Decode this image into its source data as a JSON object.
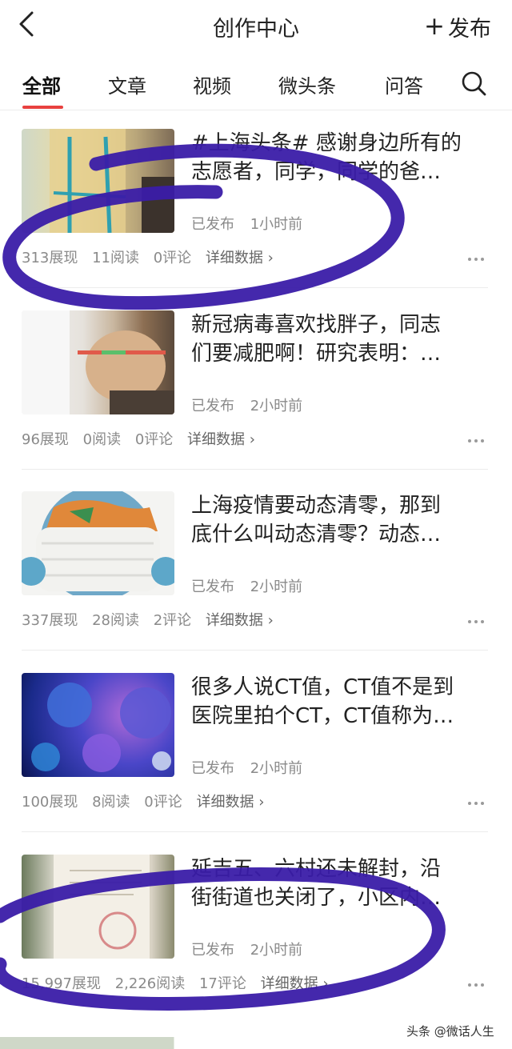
{
  "header": {
    "title": "创作中心",
    "publish_label": "发布"
  },
  "tabs": [
    {
      "label": "全部",
      "active": true
    },
    {
      "label": "文章",
      "active": false
    },
    {
      "label": "视频",
      "active": false
    },
    {
      "label": "微头条",
      "active": false
    },
    {
      "label": "问答",
      "active": false
    }
  ],
  "articles": [
    {
      "title_line1": "#上海头条# 感谢身边所有的",
      "title_line2": "志愿者，同学，同学的爸…",
      "status": "已发布",
      "time": "1小时前",
      "impressions": "313展现",
      "reads": "11阅读",
      "comments": "0评论",
      "detail": "详细数据 ›"
    },
    {
      "title_line1": "新冠病毒喜欢找胖子，同志",
      "title_line2": "们要减肥啊！研究表明：…",
      "status": "已发布",
      "time": "2小时前",
      "impressions": "96展现",
      "reads": "0阅读",
      "comments": "0评论",
      "detail": "详细数据 ›"
    },
    {
      "title_line1": "上海疫情要动态清零，那到",
      "title_line2": "底什么叫动态清零？动态…",
      "status": "已发布",
      "time": "2小时前",
      "impressions": "337展现",
      "reads": "28阅读",
      "comments": "2评论",
      "detail": "详细数据 ›"
    },
    {
      "title_line1": "很多人说CT值，CT值不是到",
      "title_line2": "医院里拍个CT，CT值称为…",
      "status": "已发布",
      "time": "2小时前",
      "impressions": "100展现",
      "reads": "8阅读",
      "comments": "0评论",
      "detail": "详细数据 ›"
    },
    {
      "title_line1": "延吉五、六村还未解封，沿",
      "title_line2": "街街道也关闭了，小区内…",
      "status": "已发布",
      "time": "2小时前",
      "impressions": "15,997展现",
      "reads": "2,226阅读",
      "comments": "17评论",
      "detail": "详细数据 ›"
    }
  ],
  "watermark": "头条 @微话人生",
  "colors": {
    "accent": "#e8413f",
    "annotation": "#3a1ca8"
  },
  "icons": [
    "back-arrow-icon",
    "plus-icon",
    "search-icon",
    "more-dots-icon",
    "chevron-right-icon"
  ]
}
